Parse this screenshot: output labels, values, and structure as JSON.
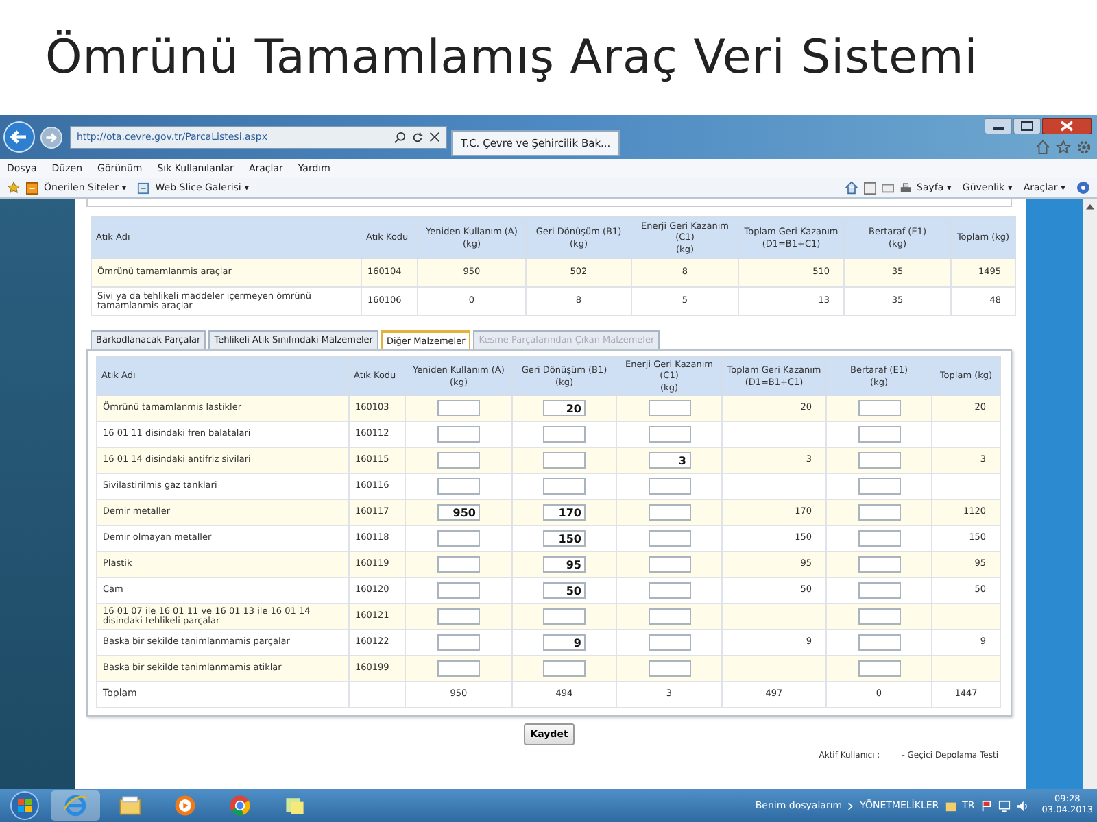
{
  "slide_title": "Ömrünü Tamamlamış Araç Veri Sistemi",
  "browser": {
    "address": "http://ota.cevre.gov.tr/ParcaListesi.aspx",
    "tab": "T.C. Çevre ve Şehircilik Bak...",
    "menu": [
      "Dosya",
      "Düzen",
      "Görünüm",
      "Sık Kullanılanlar",
      "Araçlar",
      "Yardım"
    ],
    "favorites": [
      "Önerilen Siteler ▾",
      "Web Slice Galerisi ▾"
    ],
    "commands": [
      "Sayfa ▾",
      "Güvenlik ▾",
      "Araçlar ▾"
    ]
  },
  "summary_table": {
    "columns": [
      "Atık Adı",
      "Atık Kodu",
      "Yeniden Kullanım (A)\n(kg)",
      "Geri Dönüşüm (B1)\n(kg)",
      "Enerji Geri Kazanım\n(C1)\n(kg)",
      "Toplam Geri Kazanım\n(D1=B1+C1)",
      "Bertaraf (E1)\n(kg)",
      "Toplam (kg)"
    ],
    "rows": [
      [
        "Ömrünü tamamlanmis araçlar",
        "160104",
        "950",
        "502",
        "8",
        "510",
        "35",
        "1495"
      ],
      [
        "Sivi ya da tehlikeli maddeler içermeyen ömrünü tamamlanmis araçlar",
        "160106",
        "0",
        "8",
        "5",
        "13",
        "35",
        "48"
      ]
    ]
  },
  "tabs": [
    {
      "label": "Barkodlanacak Parçalar",
      "selected": false,
      "disabled": false
    },
    {
      "label": "Tehlikeli Atık Sınıfındaki Malzemeler",
      "selected": false,
      "disabled": false
    },
    {
      "label": "Diğer Malzemeler",
      "selected": true,
      "disabled": false
    },
    {
      "label": "Kesme Parçalarından Çıkan Malzemeler",
      "selected": false,
      "disabled": true
    }
  ],
  "detail_table": {
    "columns": [
      {
        "label": "Atık Adı",
        "kind": "text"
      },
      {
        "label": "Atık Kodu",
        "kind": "text"
      },
      {
        "label": "Yeniden Kullanım (A)\n(kg)",
        "kind": "input"
      },
      {
        "label": "Geri Dönüşüm (B1)\n(kg)",
        "kind": "input"
      },
      {
        "label": "Enerji Geri Kazanım\n(C1)\n(kg)",
        "kind": "input"
      },
      {
        "label": "Toplam Geri Kazanım\n(D1=B1+C1)",
        "kind": "text"
      },
      {
        "label": "Bertaraf (E1)\n(kg)",
        "kind": "input"
      },
      {
        "label": "Toplam (kg)",
        "kind": "text"
      }
    ],
    "rows": [
      {
        "kind": "entry",
        "cells": [
          "Ömrünü tamamlanmis lastikler",
          "160103",
          null,
          "20",
          null,
          "20",
          null,
          "20"
        ]
      },
      {
        "kind": "entry",
        "cells": [
          "16 01 11 disindaki fren balatalari",
          "160112",
          null,
          null,
          null,
          null,
          null,
          null
        ]
      },
      {
        "kind": "entry",
        "cells": [
          "16 01 14 disindaki antifriz sivilari",
          "160115",
          null,
          null,
          "3",
          "3",
          null,
          "3"
        ]
      },
      {
        "kind": "entry",
        "cells": [
          "Sivilastirilmis gaz tanklari",
          "160116",
          null,
          null,
          null,
          null,
          null,
          null
        ]
      },
      {
        "kind": "entry",
        "cells": [
          "Demir metaller",
          "160117",
          "950",
          "170",
          null,
          "170",
          null,
          "1120"
        ]
      },
      {
        "kind": "entry",
        "cells": [
          "Demir olmayan metaller",
          "160118",
          null,
          "150",
          null,
          "150",
          null,
          "150"
        ]
      },
      {
        "kind": "entry",
        "cells": [
          "Plastik",
          "160119",
          null,
          "95",
          null,
          "95",
          null,
          "95"
        ]
      },
      {
        "kind": "entry",
        "cells": [
          "Cam",
          "160120",
          null,
          "50",
          null,
          "50",
          null,
          "50"
        ]
      },
      {
        "kind": "entry",
        "cells": [
          "16 01 07 ile 16 01 11 ve 16 01 13 ile 16 01 14 disindaki tehlikeli parçalar",
          "160121",
          null,
          null,
          null,
          null,
          null,
          null
        ]
      },
      {
        "kind": "entry",
        "cells": [
          "Baska bir sekilde tanimlanmamis parçalar",
          "160122",
          null,
          "9",
          null,
          "9",
          null,
          "9"
        ]
      },
      {
        "kind": "entry",
        "cells": [
          "Baska bir sekilde tanimlanmamis atiklar",
          "160199",
          null,
          null,
          null,
          null,
          null,
          null
        ]
      },
      {
        "kind": "total",
        "cells": [
          "Toplam",
          null,
          "950",
          "494",
          "3",
          "497",
          "0",
          "1447"
        ]
      }
    ]
  },
  "save_button": "Kaydet",
  "footer": {
    "user_label": "Aktif Kullanıcı :",
    "user_value": "- Geçici Depolama Testi"
  },
  "taskbar": {
    "toolbars": [
      "Benim dosyalarım",
      "YÖNETMELİKLER"
    ],
    "language": "TR",
    "time": "09:28",
    "date": "03.04.2013"
  }
}
